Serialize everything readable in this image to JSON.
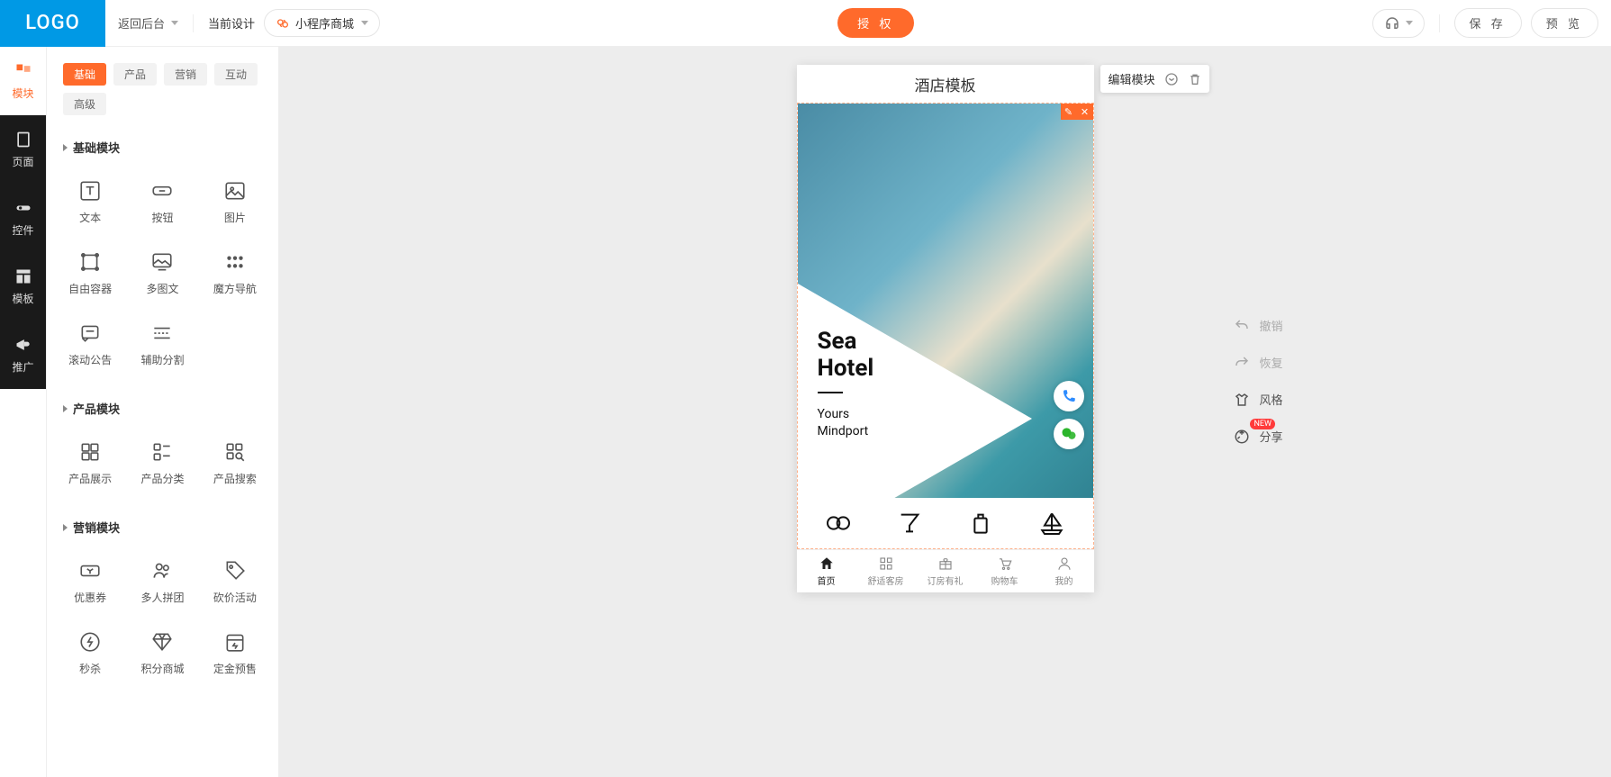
{
  "topbar": {
    "logo": "LOGO",
    "back": "返回后台",
    "current_design_label": "当前设计",
    "current_design_value": "小程序商城",
    "authorize": "授 权",
    "save": "保 存",
    "preview": "预 览"
  },
  "rail": [
    {
      "label": "模块"
    },
    {
      "label": "页面"
    },
    {
      "label": "控件"
    },
    {
      "label": "模板"
    },
    {
      "label": "推广"
    }
  ],
  "tabs": {
    "t0": "基础",
    "t1": "产品",
    "t2": "营销",
    "t3": "互动",
    "t4": "高级"
  },
  "sections": {
    "basic": {
      "title": "基础模块",
      "items": [
        "文本",
        "按钮",
        "图片",
        "自由容器",
        "多图文",
        "魔方导航",
        "滚动公告",
        "辅助分割"
      ]
    },
    "product": {
      "title": "产品模块",
      "items": [
        "产品展示",
        "产品分类",
        "产品搜索"
      ]
    },
    "marketing": {
      "title": "营销模块",
      "items": [
        "优惠券",
        "多人拼团",
        "砍价活动",
        "秒杀",
        "积分商城",
        "定金预售"
      ]
    }
  },
  "preview": {
    "page_title": "酒店模板",
    "edit_module": "编辑模块",
    "hero": {
      "title1": "Sea",
      "title2": "Hotel",
      "sub1": "Yours",
      "sub2": "Mindport"
    },
    "tabbar": [
      "首页",
      "舒适客房",
      "订房有礼",
      "购物车",
      "我的"
    ]
  },
  "side_tools": {
    "undo": "撤销",
    "redo": "恢复",
    "style": "风格",
    "share": "分享",
    "badge": "NEW"
  }
}
